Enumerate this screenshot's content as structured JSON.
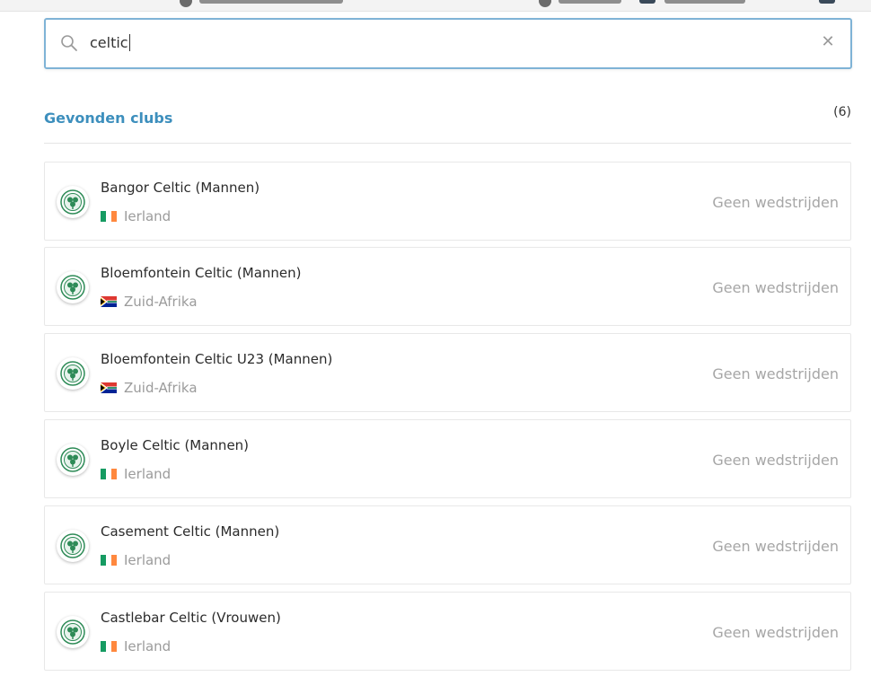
{
  "search": {
    "value": "celtic",
    "icon": "search-icon",
    "clear_icon": "close-icon",
    "clear_symbol": "✕"
  },
  "results": {
    "heading": "Gevonden clubs",
    "count": "(6)",
    "items": [
      {
        "name": "Bangor Celtic (Mannen)",
        "country": "Ierland",
        "flag": "ireland",
        "status": "Geen wedstrijden"
      },
      {
        "name": "Bloemfontein Celtic (Mannen)",
        "country": "Zuid-Afrika",
        "flag": "south-africa",
        "status": "Geen wedstrijden"
      },
      {
        "name": "Bloemfontein Celtic U23 (Mannen)",
        "country": "Zuid-Afrika",
        "flag": "south-africa",
        "status": "Geen wedstrijden"
      },
      {
        "name": "Boyle Celtic (Mannen)",
        "country": "Ierland",
        "flag": "ireland",
        "status": "Geen wedstrijden"
      },
      {
        "name": "Casement Celtic (Mannen)",
        "country": "Ierland",
        "flag": "ireland",
        "status": "Geen wedstrijden"
      },
      {
        "name": "Castlebar Celtic (Vrouwen)",
        "country": "Ierland",
        "flag": "ireland",
        "status": "Geen wedstrijden"
      }
    ]
  },
  "colors": {
    "accent": "#3d8fbd",
    "search_border": "#7fb3d6",
    "muted": "#a6a6a6",
    "crest_green": "#2e8b57"
  }
}
